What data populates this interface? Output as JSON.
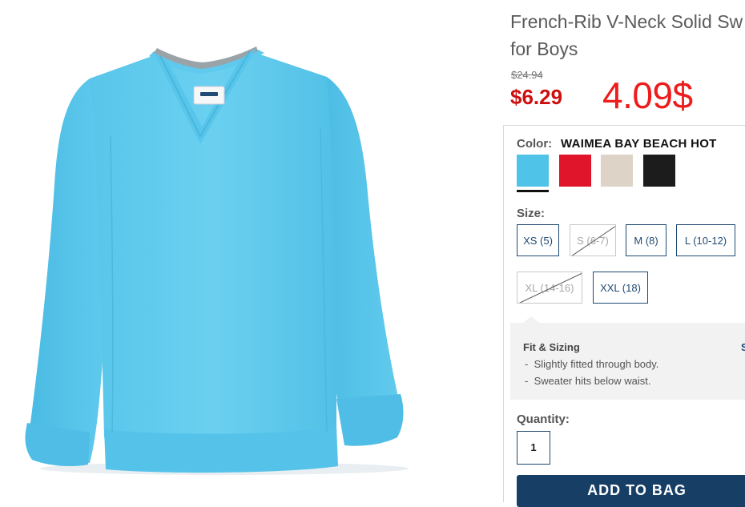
{
  "product": {
    "title_line1": "French-Rib V-Neck Solid Sw",
    "title_line2": "for Boys",
    "original_price": "$24.94",
    "sale_price": "$6.29",
    "annotation_price": "4.09$",
    "image_icon": "light-blue-v-neck-sweater-image"
  },
  "color": {
    "label": "Color:",
    "selected_name": "WAIMEA BAY BEACH HOT",
    "swatches": [
      {
        "name": "light-blue",
        "hex": "#4fc3e8",
        "selected": true
      },
      {
        "name": "red",
        "hex": "#e0142a",
        "selected": false
      },
      {
        "name": "oatmeal",
        "hex": "#ddd3c6",
        "selected": false
      },
      {
        "name": "black",
        "hex": "#1c1c1c",
        "selected": false
      }
    ]
  },
  "size": {
    "label": "Size:",
    "options": [
      {
        "label": "XS (5)",
        "available": true
      },
      {
        "label": "S (6-7)",
        "available": false
      },
      {
        "label": "M (8)",
        "available": true
      },
      {
        "label": "L (10-12)",
        "available": true
      },
      {
        "label": "XL (14-16)",
        "available": false
      },
      {
        "label": "XXL (18)",
        "available": true
      }
    ]
  },
  "fit": {
    "title": "Fit & Sizing",
    "side_link": "S",
    "items": [
      "Slightly fitted through body.",
      "Sweater hits below waist."
    ]
  },
  "quantity": {
    "label": "Quantity:",
    "value": "1"
  },
  "add_to_bag": "ADD TO BAG",
  "colors": {
    "price_red": "#cc1010",
    "annotation_red": "#ee1c1c",
    "navy": "#173f66",
    "border_navy": "#1e4a73"
  }
}
